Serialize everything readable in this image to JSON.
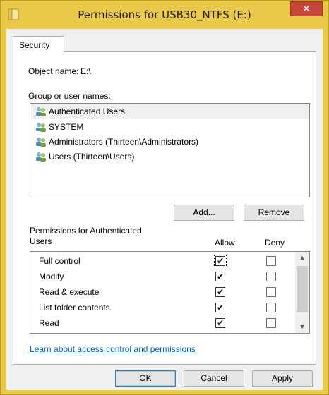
{
  "window": {
    "title": "Permissions for USB30_NTFS (E:)",
    "close_glyph": "✕"
  },
  "tabs": [
    {
      "label": "Security"
    }
  ],
  "object": {
    "label": "Object name:",
    "value": "E:\\"
  },
  "groups": {
    "label": "Group or user names:",
    "items": [
      {
        "label": "Authenticated Users",
        "selected": true
      },
      {
        "label": "SYSTEM"
      },
      {
        "label": "Administrators (Thirteen\\Administrators)"
      },
      {
        "label": "Users (Thirteen\\Users)"
      }
    ]
  },
  "buttons": {
    "add": "Add...",
    "remove": "Remove",
    "ok": "OK",
    "cancel": "Cancel",
    "apply": "Apply"
  },
  "permissions": {
    "label_line1": "Permissions for Authenticated",
    "label_line2": "Users",
    "allow_header": "Allow",
    "deny_header": "Deny",
    "rows": [
      {
        "label": "Full control",
        "allow": true,
        "deny": false
      },
      {
        "label": "Modify",
        "allow": true,
        "deny": false
      },
      {
        "label": "Read & execute",
        "allow": true,
        "deny": false
      },
      {
        "label": "List folder contents",
        "allow": true,
        "deny": false
      },
      {
        "label": "Read",
        "allow": true,
        "deny": false
      }
    ]
  },
  "link": "Learn about access control and permissions",
  "icons": {
    "app": "folder-icon",
    "user": "users-icon",
    "scroll_up": "▲",
    "scroll_down": "▼",
    "check": "✔"
  },
  "colors": {
    "title_bar": "#eac84a",
    "close_button": "#c7463a",
    "link": "#0066cc"
  }
}
